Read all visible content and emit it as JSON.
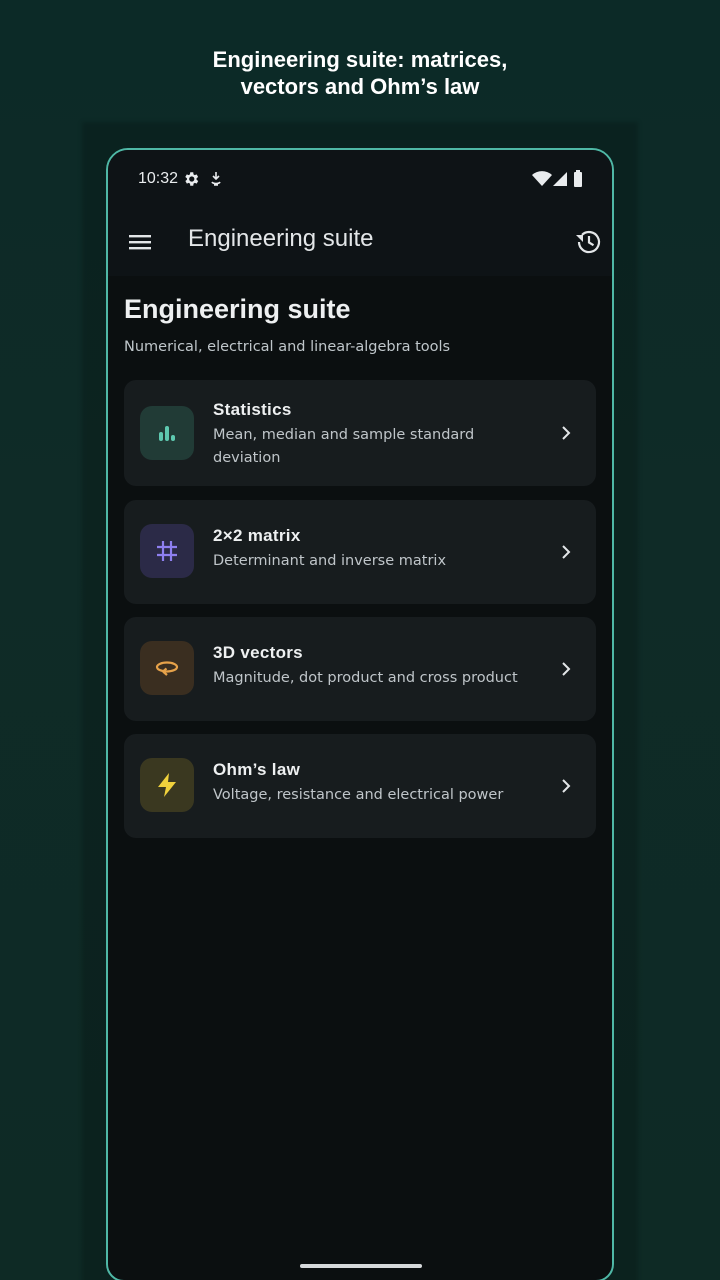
{
  "promo": {
    "title": "Engineering suite: matrices,\nvectors and Ohm’s law"
  },
  "statusbar": {
    "time": "10:32",
    "icons": [
      "settings-gear-icon",
      "download-icon",
      "wifi-icon",
      "cell-signal-icon",
      "battery-icon"
    ]
  },
  "appbar": {
    "title": "Engineering suite",
    "menu_icon": "menu-icon",
    "history_icon": "history-icon"
  },
  "main": {
    "heading": "Engineering suite",
    "subtitle": "Numerical, electrical and linear-algebra tools",
    "tools": [
      {
        "title": "Statistics",
        "description": "Mean, median and sample standard deviation",
        "icon": "bar-chart-icon",
        "accent": "#5ec9b0",
        "icon_bg": "#213b36"
      },
      {
        "title": "2×2 matrix",
        "description": "Determinant and inverse matrix",
        "icon": "grid-icon",
        "accent": "#8e7ff0",
        "icon_bg": "#2b2a47"
      },
      {
        "title": "3D vectors",
        "description": "Magnitude, dot product and cross product",
        "icon": "rotate-3d-icon",
        "accent": "#e6a24a",
        "icon_bg": "#3a2e20"
      },
      {
        "title": "Ohm’s law",
        "description": "Voltage, resistance and electrical power",
        "icon": "lightning-bolt-icon",
        "accent": "#f0d23c",
        "icon_bg": "#3a3820"
      }
    ]
  },
  "colors": {
    "background": "#0f2b27",
    "frame_border": "#4fb8a6",
    "card_bg": "#171c1e"
  }
}
